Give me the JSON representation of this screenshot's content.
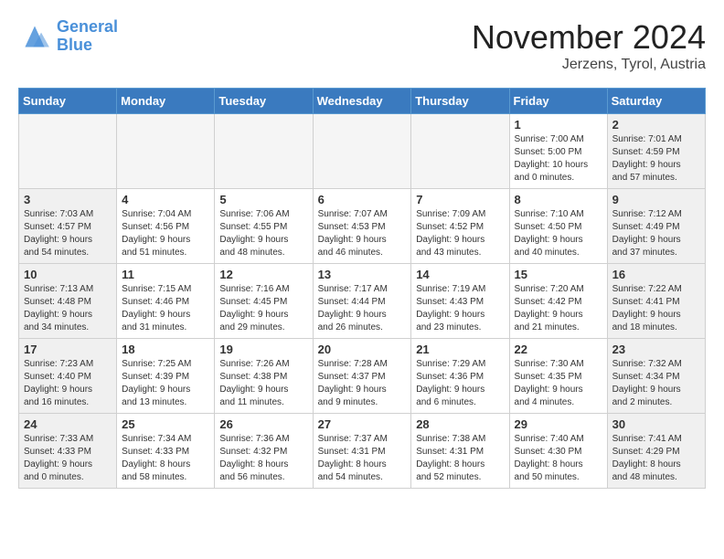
{
  "header": {
    "logo_line1": "General",
    "logo_line2": "Blue",
    "month": "November 2024",
    "location": "Jerzens, Tyrol, Austria"
  },
  "weekdays": [
    "Sunday",
    "Monday",
    "Tuesday",
    "Wednesday",
    "Thursday",
    "Friday",
    "Saturday"
  ],
  "weeks": [
    [
      {
        "day": "",
        "info": "",
        "empty": true
      },
      {
        "day": "",
        "info": "",
        "empty": true
      },
      {
        "day": "",
        "info": "",
        "empty": true
      },
      {
        "day": "",
        "info": "",
        "empty": true
      },
      {
        "day": "",
        "info": "",
        "empty": true
      },
      {
        "day": "1",
        "info": "Sunrise: 7:00 AM\nSunset: 5:00 PM\nDaylight: 10 hours\nand 0 minutes."
      },
      {
        "day": "2",
        "info": "Sunrise: 7:01 AM\nSunset: 4:59 PM\nDaylight: 9 hours\nand 57 minutes."
      }
    ],
    [
      {
        "day": "3",
        "info": "Sunrise: 7:03 AM\nSunset: 4:57 PM\nDaylight: 9 hours\nand 54 minutes."
      },
      {
        "day": "4",
        "info": "Sunrise: 7:04 AM\nSunset: 4:56 PM\nDaylight: 9 hours\nand 51 minutes."
      },
      {
        "day": "5",
        "info": "Sunrise: 7:06 AM\nSunset: 4:55 PM\nDaylight: 9 hours\nand 48 minutes."
      },
      {
        "day": "6",
        "info": "Sunrise: 7:07 AM\nSunset: 4:53 PM\nDaylight: 9 hours\nand 46 minutes."
      },
      {
        "day": "7",
        "info": "Sunrise: 7:09 AM\nSunset: 4:52 PM\nDaylight: 9 hours\nand 43 minutes."
      },
      {
        "day": "8",
        "info": "Sunrise: 7:10 AM\nSunset: 4:50 PM\nDaylight: 9 hours\nand 40 minutes."
      },
      {
        "day": "9",
        "info": "Sunrise: 7:12 AM\nSunset: 4:49 PM\nDaylight: 9 hours\nand 37 minutes."
      }
    ],
    [
      {
        "day": "10",
        "info": "Sunrise: 7:13 AM\nSunset: 4:48 PM\nDaylight: 9 hours\nand 34 minutes."
      },
      {
        "day": "11",
        "info": "Sunrise: 7:15 AM\nSunset: 4:46 PM\nDaylight: 9 hours\nand 31 minutes."
      },
      {
        "day": "12",
        "info": "Sunrise: 7:16 AM\nSunset: 4:45 PM\nDaylight: 9 hours\nand 29 minutes."
      },
      {
        "day": "13",
        "info": "Sunrise: 7:17 AM\nSunset: 4:44 PM\nDaylight: 9 hours\nand 26 minutes."
      },
      {
        "day": "14",
        "info": "Sunrise: 7:19 AM\nSunset: 4:43 PM\nDaylight: 9 hours\nand 23 minutes."
      },
      {
        "day": "15",
        "info": "Sunrise: 7:20 AM\nSunset: 4:42 PM\nDaylight: 9 hours\nand 21 minutes."
      },
      {
        "day": "16",
        "info": "Sunrise: 7:22 AM\nSunset: 4:41 PM\nDaylight: 9 hours\nand 18 minutes."
      }
    ],
    [
      {
        "day": "17",
        "info": "Sunrise: 7:23 AM\nSunset: 4:40 PM\nDaylight: 9 hours\nand 16 minutes."
      },
      {
        "day": "18",
        "info": "Sunrise: 7:25 AM\nSunset: 4:39 PM\nDaylight: 9 hours\nand 13 minutes."
      },
      {
        "day": "19",
        "info": "Sunrise: 7:26 AM\nSunset: 4:38 PM\nDaylight: 9 hours\nand 11 minutes."
      },
      {
        "day": "20",
        "info": "Sunrise: 7:28 AM\nSunset: 4:37 PM\nDaylight: 9 hours\nand 9 minutes."
      },
      {
        "day": "21",
        "info": "Sunrise: 7:29 AM\nSunset: 4:36 PM\nDaylight: 9 hours\nand 6 minutes."
      },
      {
        "day": "22",
        "info": "Sunrise: 7:30 AM\nSunset: 4:35 PM\nDaylight: 9 hours\nand 4 minutes."
      },
      {
        "day": "23",
        "info": "Sunrise: 7:32 AM\nSunset: 4:34 PM\nDaylight: 9 hours\nand 2 minutes."
      }
    ],
    [
      {
        "day": "24",
        "info": "Sunrise: 7:33 AM\nSunset: 4:33 PM\nDaylight: 9 hours\nand 0 minutes."
      },
      {
        "day": "25",
        "info": "Sunrise: 7:34 AM\nSunset: 4:33 PM\nDaylight: 8 hours\nand 58 minutes."
      },
      {
        "day": "26",
        "info": "Sunrise: 7:36 AM\nSunset: 4:32 PM\nDaylight: 8 hours\nand 56 minutes."
      },
      {
        "day": "27",
        "info": "Sunrise: 7:37 AM\nSunset: 4:31 PM\nDaylight: 8 hours\nand 54 minutes."
      },
      {
        "day": "28",
        "info": "Sunrise: 7:38 AM\nSunset: 4:31 PM\nDaylight: 8 hours\nand 52 minutes."
      },
      {
        "day": "29",
        "info": "Sunrise: 7:40 AM\nSunset: 4:30 PM\nDaylight: 8 hours\nand 50 minutes."
      },
      {
        "day": "30",
        "info": "Sunrise: 7:41 AM\nSunset: 4:29 PM\nDaylight: 8 hours\nand 48 minutes."
      }
    ]
  ]
}
